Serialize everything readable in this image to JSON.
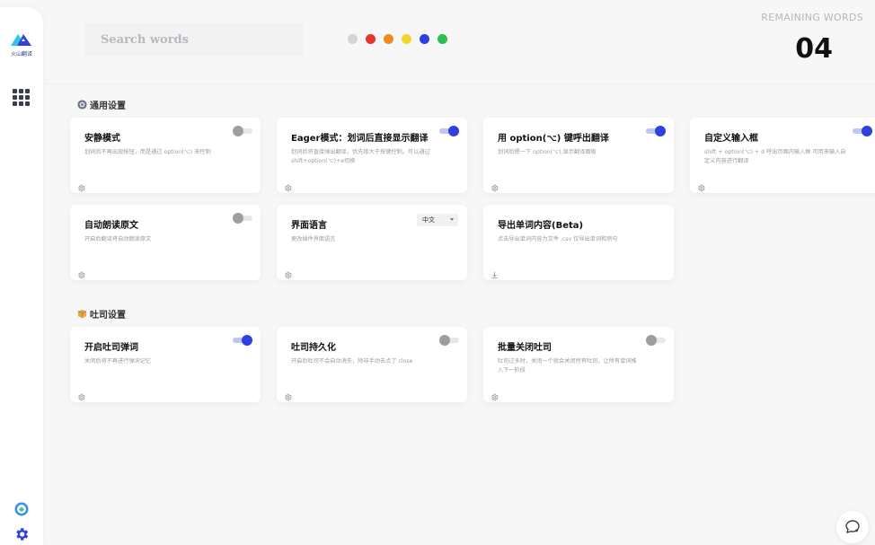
{
  "sidebar": {
    "logo_text": "火山翻译",
    "icons": [
      "app-logo-icon",
      "grid-icon",
      "avatar-icon",
      "gear-icon"
    ]
  },
  "header": {
    "search_placeholder": "Search words",
    "color_dots": [
      "#d4d4d6",
      "#e8342a",
      "#f08a1d",
      "#f5d52a",
      "#2f3fe0",
      "#2ebd4f"
    ],
    "remaining_label": "REMAINING WORDS",
    "remaining_count": "04"
  },
  "sections": {
    "general": {
      "title": "通用设置",
      "icon": "settings-circle-icon",
      "cards": [
        {
          "title": "安静模式",
          "desc": "划词后不再出现按钮，而是通过 option(⌥) 来控制",
          "control": "toggle",
          "on": false,
          "foot_icon": "gear-icon"
        },
        {
          "title": "Eager模式：划词后直接显示翻译",
          "desc": "划词后将直接弹出翻译，优先级大于按键控制。可以通过 shift+option(⌥)+e切换",
          "control": "toggle",
          "on": true,
          "foot_icon": "gear-icon"
        },
        {
          "title": "用 option(⌥) 键呼出翻译",
          "desc": "划词后摁一下 option(⌥) 显示翻译面板",
          "control": "toggle",
          "on": true,
          "foot_icon": "gear-icon"
        },
        {
          "title": "自定义输入框",
          "desc": "shift + option(⌥) + d 呼出页面内输入框 可用来输入自定义内容进行翻译",
          "control": "toggle",
          "on": true,
          "foot_icon": "gear-icon"
        },
        {
          "title": "自动朗读原文",
          "desc": "开启后翻译将自动朗读原文",
          "control": "toggle",
          "on": false,
          "foot_icon": "gear-icon"
        },
        {
          "title": "界面语言",
          "desc": "更改插件界面语言",
          "control": "select",
          "value": "中文",
          "foot_icon": "gear-icon"
        },
        {
          "title": "导出单词内容(Beta)",
          "desc": "点击导出单词内容为文件 .csv 仅导出单词和例句",
          "control": "none",
          "foot_icon": "download-icon"
        }
      ]
    },
    "toast": {
      "title": "吐司设置",
      "icon": "box-icon",
      "cards": [
        {
          "title": "开启吐司弹词",
          "desc": "关闭后将不再进行弹词记忆",
          "control": "toggle",
          "on": true,
          "foot_icon": "gear-icon"
        },
        {
          "title": "吐司持久化",
          "desc": "开启后吐司不会自动消失，除非手动去点了 close",
          "control": "toggle",
          "on": false,
          "foot_icon": "gear-icon"
        },
        {
          "title": "批量关闭吐司",
          "desc": "吐司过多时，关闭一个就会关闭所有吐司，让所有单词推入下一阶段",
          "control": "toggle",
          "on": false,
          "foot_icon": "gear-icon"
        }
      ]
    }
  },
  "chat_button": {
    "icon": "chat-bubble-icon"
  }
}
